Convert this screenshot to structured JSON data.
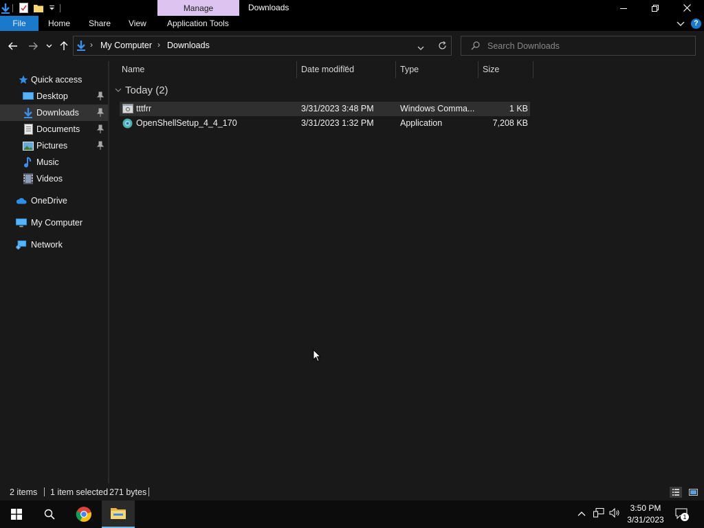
{
  "titlebar": {
    "manage_label": "Manage",
    "title": "Downloads",
    "minimize_icon": "minimize-icon",
    "restore_icon": "restore-icon",
    "close_icon": "close-icon"
  },
  "ribbon": {
    "tabs": [
      {
        "label": "File"
      },
      {
        "label": "Home"
      },
      {
        "label": "Share"
      },
      {
        "label": "View"
      },
      {
        "label": "Application Tools"
      }
    ],
    "help_label": "?"
  },
  "address": {
    "crumbs": [
      "My Computer",
      "Downloads"
    ],
    "search_placeholder": "Search Downloads"
  },
  "navpane": {
    "items": [
      {
        "label": "Quick access",
        "icon": "star-icon"
      },
      {
        "label": "Desktop",
        "icon": "desktop-icon",
        "pinned": true
      },
      {
        "label": "Downloads",
        "icon": "download-icon",
        "pinned": true,
        "selected": true
      },
      {
        "label": "Documents",
        "icon": "documents-icon",
        "pinned": true
      },
      {
        "label": "Pictures",
        "icon": "pictures-icon",
        "pinned": true
      },
      {
        "label": "Music",
        "icon": "music-icon"
      },
      {
        "label": "Videos",
        "icon": "videos-icon"
      },
      {
        "label": "OneDrive",
        "icon": "cloud-icon"
      },
      {
        "label": "My Computer",
        "icon": "computer-icon"
      },
      {
        "label": "Network",
        "icon": "network-icon"
      }
    ]
  },
  "columns": [
    "Name",
    "Date modified",
    "Type",
    "Size"
  ],
  "group": {
    "label": "Today (2)"
  },
  "files": [
    {
      "name": "tttfrr",
      "date": "3/31/2023 3:48 PM",
      "type": "Windows Comma...",
      "size": "1 KB",
      "selected": true
    },
    {
      "name": "OpenShellSetup_4_4_170",
      "date": "3/31/2023 1:32 PM",
      "type": "Application",
      "size": "7,208 KB",
      "selected": false
    }
  ],
  "status": {
    "items": "2 items",
    "selected": "1 item selected",
    "bytes": "271 bytes"
  },
  "taskbar": {
    "time": "3:50 PM",
    "date": "3/31/2023",
    "notification_count": "1"
  },
  "colors": {
    "accent": "#1979ca",
    "manage_tab": "#dcc3f0",
    "background": "#191919"
  }
}
